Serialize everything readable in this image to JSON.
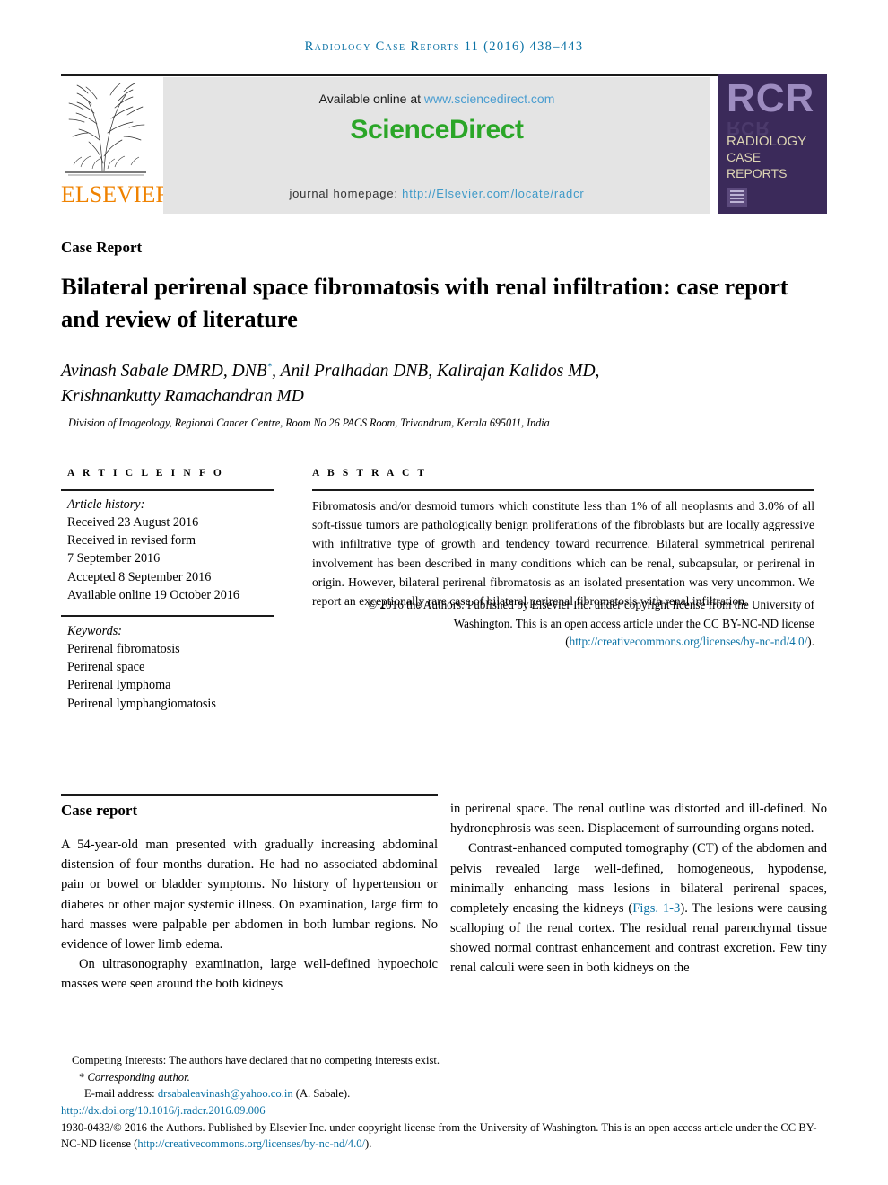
{
  "running_head": "Radiology Case Reports 11 (2016) 438–443",
  "masthead": {
    "available_prefix": "Available online at ",
    "available_link": "www.sciencedirect.com",
    "sciencedirect_logo": "ScienceDirect",
    "homepage_prefix": "journal homepage: ",
    "homepage_link": "http://Elsevier.com/locate/radcr",
    "elsevier_word": "ELSEVIER",
    "rcr": {
      "letters": "RCR",
      "line1": "RADIOLOGY",
      "line2": "CASE",
      "line3": "REPORTS"
    }
  },
  "article": {
    "section_label": "Case Report",
    "title": "Bilateral perirenal space fibromatosis with renal infiltration: case report and review of literature",
    "authors_line1": "Avinash Sabale DMRD, DNB",
    "authors_star": "*",
    "authors_line1_cont": ", Anil Pralhadan DNB, Kalirajan Kalidos MD,",
    "authors_line2": "Krishnankutty Ramachandran MD",
    "affiliation": "Division of Imageology, Regional Cancer Centre, Room No 26 PACS Room, Trivandrum, Kerala 695011, India"
  },
  "article_info": {
    "heading": "A R T I C L E   I N F O",
    "history_label": "Article history:",
    "history": [
      "Received 23 August 2016",
      "Received in revised form",
      "7 September 2016",
      "Accepted 8 September 2016",
      "Available online 19 October 2016"
    ],
    "keywords_label": "Keywords:",
    "keywords": [
      "Perirenal fibromatosis",
      "Perirenal space",
      "Perirenal lymphoma",
      "Perirenal lymphangiomatosis"
    ]
  },
  "abstract": {
    "heading": "A B S T R A C T",
    "text": "Fibromatosis and/or desmoid tumors which constitute less than 1% of all neoplasms and 3.0% of all soft-tissue tumors are pathologically benign proliferations of the fibroblasts but are locally aggressive with infiltrative type of growth and tendency toward recurrence. Bilateral symmetrical perirenal involvement has been described in many conditions which can be renal, subcapsular, or perirenal in origin. However, bilateral perirenal fibromatosis as an isolated presentation was very uncommon. We report an exceptionally rare case of bilateral perirenal fibromatosis with renal infiltration.",
    "copyright_text": "© 2016 the Authors. Published by Elsevier Inc. under copyright license from the University of Washington. This is an open access article under the CC BY-NC-ND license (",
    "copyright_link": "http://creativecommons.org/licenses/by-nc-nd/4.0/",
    "copyright_tail": ")."
  },
  "body": {
    "heading": "Case report",
    "left_p1": "A 54-year-old man presented with gradually increasing abdominal distension of four months duration. He had no associated abdominal pain or bowel or bladder symptoms. No history of hypertension or diabetes or other major systemic illness. On examination, large firm to hard masses were palpable per abdomen in both lumbar regions. No evidence of lower limb edema.",
    "left_p2": "On ultrasonography examination, large well-defined hypoechoic masses were seen around the both kidneys",
    "right_p1": "in perirenal space. The renal outline was distorted and ill-defined. No hydronephrosis was seen. Displacement of surrounding organs noted.",
    "right_p2_a": "Contrast-enhanced computed tomography (CT) of the abdomen and pelvis revealed large well-defined, homogeneous, hypodense, minimally enhancing mass lesions in bilateral perirenal spaces, completely encasing the kidneys (",
    "right_p2_link": "Figs. 1-3",
    "right_p2_b": "). The lesions were causing scalloping of the renal cortex. The residual renal parenchymal tissue showed normal contrast enhancement and contrast excretion. Few tiny renal calculi were seen in both kidneys on the"
  },
  "footnotes": {
    "competing": "Competing Interests: The authors have declared that no competing interests exist.",
    "corresponding_star": "*",
    "corresponding": "Corresponding author.",
    "email_label": "E-mail address: ",
    "email_link": "drsabaleavinash@yahoo.co.in",
    "email_tail": " (A. Sabale).",
    "doi_link": "http://dx.doi.org/10.1016/j.radcr.2016.09.006",
    "license_a": "1930-0433/© 2016 the Authors. Published by Elsevier Inc. under copyright license from the University of Washington. This is an open access article under the CC BY-NC-ND license (",
    "license_link": "http://creativecommons.org/licenses/by-nc-nd/4.0/",
    "license_tail": ")."
  },
  "colors": {
    "link": "#0b72a5",
    "sciencedirect_green": "#2ba628",
    "elsevier_orange": "#ef8200",
    "rcr_purple": "#3b2a5a",
    "rcr_letters": "#9d8cc0",
    "rcr_cream": "#ded6b4"
  }
}
